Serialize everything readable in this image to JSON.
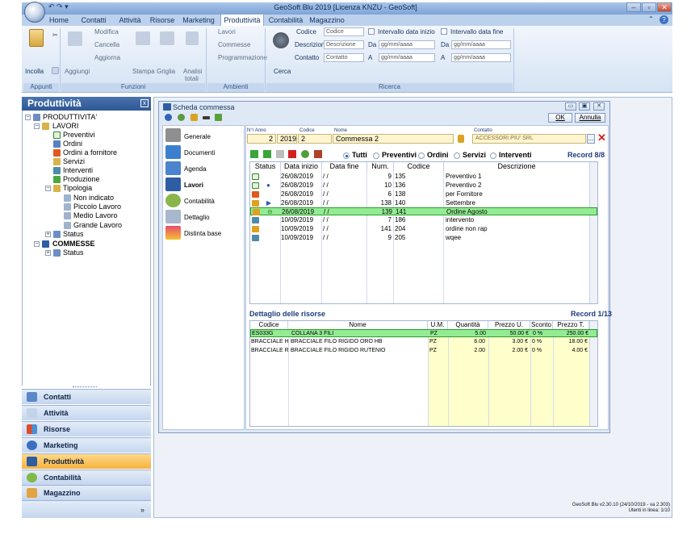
{
  "window": {
    "title": "GeoSoft Blu 2019 [Licenza KNZU - GeoSoft]",
    "minimize": "–",
    "restore": "▫",
    "close": "✕"
  },
  "ribbon_tabs": [
    "Home",
    "Contatti",
    "Attività",
    "Risorse",
    "Marketing",
    "Produttività",
    "Contabilità",
    "Magazzino"
  ],
  "ribbon": {
    "appunti": {
      "paste": "Incolla",
      "label": "Appunti"
    },
    "funzioni": {
      "add": "Aggiungi",
      "edit": "Modifica",
      "delete": "Cancella",
      "refresh": "Aggiorna",
      "print": "Stampa",
      "grid": "Griglia",
      "analysis_1": "Analisi",
      "analysis_2": "totali",
      "label": "Funzioni"
    },
    "ambienti": {
      "lavori": "Lavori",
      "commesse": "Commesse",
      "programmazione": "Programmazione",
      "label": "Ambienti"
    },
    "ricerca": {
      "search": "Cerca",
      "codice_label": "Codice",
      "codice_placeholder": "Codice",
      "descrizione_label": "Descrizione",
      "descrizione_placeholder": "Descrizione",
      "contatto_label": "Contatto",
      "contatto_placeholder": "Contatto",
      "start_range": "Intervallo data inizio",
      "end_range": "Intervallo data fine",
      "da": "Da",
      "a": "A",
      "date_placeholder": "gg/mm/aaaa",
      "label": "Ricerca"
    }
  },
  "nav": {
    "title": "Produttività",
    "close": "x",
    "tree": [
      "PRODUTTIVITA'",
      "LAVORI",
      "Preventivi",
      "Ordini",
      "Ordini a fornitore",
      "Servizi",
      "Interventi",
      "Produzione",
      "Tipologia",
      "Non indicato",
      "Piccolo Lavoro",
      "Medio Lavoro",
      "Grande Lavoro",
      "Status",
      "COMMESSE",
      "Status"
    ],
    "modules": [
      "Contatti",
      "Attività",
      "Risorse",
      "Marketing",
      "Produttività",
      "Contabilità",
      "Magazzino"
    ],
    "more": "»"
  },
  "dialog": {
    "title": "Scheda commessa",
    "ok": "OK",
    "cancel": "Annulla",
    "tabs": [
      "Generale",
      "Documenti",
      "Agenda",
      "Lavori",
      "Contabilità",
      "Dettaglio",
      "Distinta base"
    ],
    "header": {
      "num_anno_label": "N°/ Anno",
      "num": "2",
      "anno": "2019",
      "codice_label": "Codice",
      "codice": "2",
      "nome_label": "Nome",
      "nome": "Commessa 2",
      "contatto_label": "Contatto",
      "contatto": "ACCESSORI PIU' SRL"
    },
    "filters": [
      "Tutti",
      "Preventivi",
      "Ordini",
      "Servizi",
      "Interventi"
    ],
    "record": "Record 8/8",
    "columns": [
      "Status",
      "Data inizio",
      "Data fine",
      "Num.",
      "Codice",
      "Descrizione"
    ],
    "rows": [
      {
        "data_inizio": "26/08/2019",
        "data_fine": "/ /",
        "num": "9",
        "codice": "135",
        "descrizione": "Preventivo 1"
      },
      {
        "data_inizio": "26/08/2019",
        "data_fine": "/ /",
        "num": "10",
        "codice": "136",
        "descrizione": "Preventivo 2"
      },
      {
        "data_inizio": "26/08/2019",
        "data_fine": "/ /",
        "num": "6",
        "codice": "138",
        "descrizione": "per Fornitore"
      },
      {
        "data_inizio": "26/08/2019",
        "data_fine": "/ /",
        "num": "138",
        "codice": "140",
        "descrizione": "Settembre"
      },
      {
        "data_inizio": "26/08/2019",
        "data_fine": "/ /",
        "num": "139",
        "codice": "141",
        "descrizione": "Ordine Agosto"
      },
      {
        "data_inizio": "10/09/2019",
        "data_fine": "/ /",
        "num": "7",
        "codice": "186",
        "descrizione": "intervento"
      },
      {
        "data_inizio": "10/09/2019",
        "data_fine": "/ /",
        "num": "141",
        "codice": "204",
        "descrizione": "ordine non rap"
      },
      {
        "data_inizio": "10/09/2019",
        "data_fine": "/ /",
        "num": "9",
        "codice": "205",
        "descrizione": "wqee"
      }
    ],
    "resources": {
      "title": "Dettaglio delle risorse",
      "record": "Record 1/13",
      "columns": [
        "Codice",
        "Nome",
        "U.M.",
        "Quantità",
        "Prezzo U.",
        "Sconto",
        "Prezzo T."
      ],
      "rows": [
        {
          "codice": "ES033G",
          "nome": "COLLANA 3 FILI",
          "um": "PZ",
          "quantita": "5.00",
          "prezzo_u": "50.00 €",
          "sconto": "0 %",
          "prezzo_t": "250.00 €"
        },
        {
          "codice": "BRACCIALE HB",
          "nome": "BRACCIALE FILO RIGIDO ORO HB",
          "um": "PZ",
          "quantita": "6.00",
          "prezzo_u": "3.00 €",
          "sconto": "0 %",
          "prezzo_t": "18.00 €"
        },
        {
          "codice": "BRACCIALE RU",
          "nome": "BRACCIALE FILO RIGIDO RUTENIO",
          "um": "PZ",
          "quantita": "2.00",
          "prezzo_u": "2.00 €",
          "sconto": "0 %",
          "prezzo_t": "4.00 €"
        }
      ]
    }
  },
  "status": {
    "version": "GeoSoft Blu  v2.30.10 (24/10/2019 - va 2.303)",
    "users": "Utenti in linea: 1/10"
  }
}
